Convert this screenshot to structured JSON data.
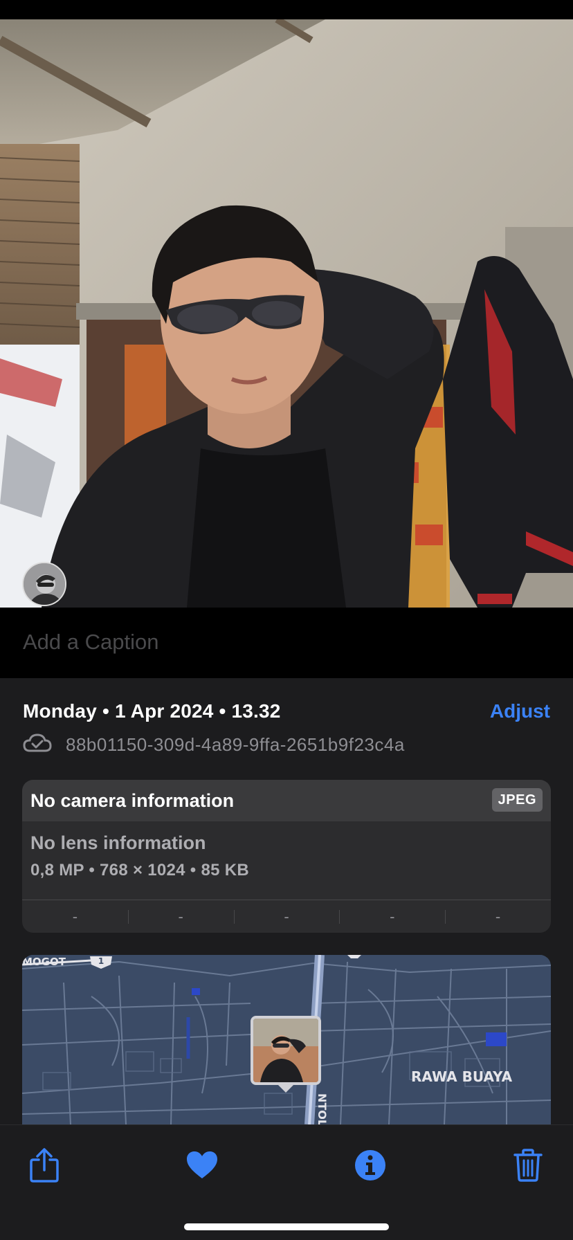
{
  "photo": {
    "subject": "portrait-photo"
  },
  "caption": {
    "placeholder": "Add a Caption"
  },
  "info": {
    "date": "Monday • 1 Apr 2024 • 13.32",
    "adjust_label": "Adjust",
    "filename": "88b01150-309d-4a89-9ffa-2651b9f23c4a",
    "cloud_icon": "cloud-check-icon"
  },
  "camera": {
    "title": "No camera information",
    "format_badge": "JPEG",
    "lens": "No lens information",
    "specs": "0,8 MP  •  768 × 1024  •  85 KB",
    "exif_values": [
      "-",
      "-",
      "-",
      "-",
      "-"
    ]
  },
  "map": {
    "labels": {
      "mogot": "MOGOT",
      "rawa_buaya": "RAWA BUAYA",
      "ntol": "NTOL",
      "route_number": "1"
    }
  },
  "toolbar": {
    "share_icon": "share-icon",
    "favorite_icon": "heart-icon",
    "info_icon": "info-icon",
    "delete_icon": "trash-icon"
  },
  "colors": {
    "accent": "#3b82f6",
    "panel": "#1c1c1e",
    "card": "#2c2c2e"
  }
}
